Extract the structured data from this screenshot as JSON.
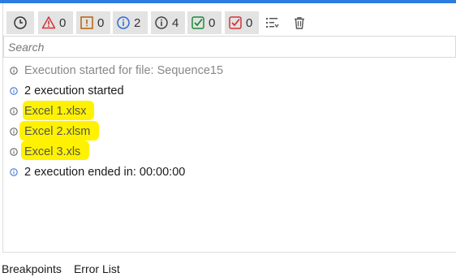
{
  "toolbar": {
    "filters": [
      {
        "name": "trace",
        "icon": "clock-icon",
        "count": null
      },
      {
        "name": "error",
        "icon": "error-triangle-icon",
        "count": "0",
        "color": "#d13438"
      },
      {
        "name": "warning",
        "icon": "warning-icon",
        "count": "0",
        "color": "#b8610c"
      },
      {
        "name": "info",
        "icon": "info-icon",
        "count": "2",
        "color": "#2f6bd6"
      },
      {
        "name": "trace-info",
        "icon": "trace-info-icon",
        "count": "4",
        "color": "#555555"
      },
      {
        "name": "success",
        "icon": "check-icon",
        "count": "0",
        "color": "#1f8a3b"
      },
      {
        "name": "failed-check",
        "icon": "check-red-icon",
        "count": "0",
        "color": "#d13438"
      }
    ],
    "actions": [
      "expand-collapse-icon",
      "trash-icon"
    ]
  },
  "search": {
    "placeholder": "Search"
  },
  "log": [
    {
      "level": "trace",
      "text": "Execution started for file: Sequence15",
      "highlight": false
    },
    {
      "level": "info",
      "text": "2 execution started",
      "highlight": false
    },
    {
      "level": "trace",
      "text": "Excel 1.xlsx",
      "highlight": true
    },
    {
      "level": "trace",
      "text": "Excel 2.xlsm",
      "highlight": true
    },
    {
      "level": "trace",
      "text": "Excel 3.xls",
      "highlight": true
    },
    {
      "level": "info",
      "text": "2 execution ended in: 00:00:00",
      "highlight": false
    }
  ],
  "bottom_tabs": [
    "Breakpoints",
    "Error List"
  ],
  "colors": {
    "accent": "#2b7de0",
    "highlight": "#fff200",
    "toolbar_button_bg": "#e3e3e3"
  }
}
